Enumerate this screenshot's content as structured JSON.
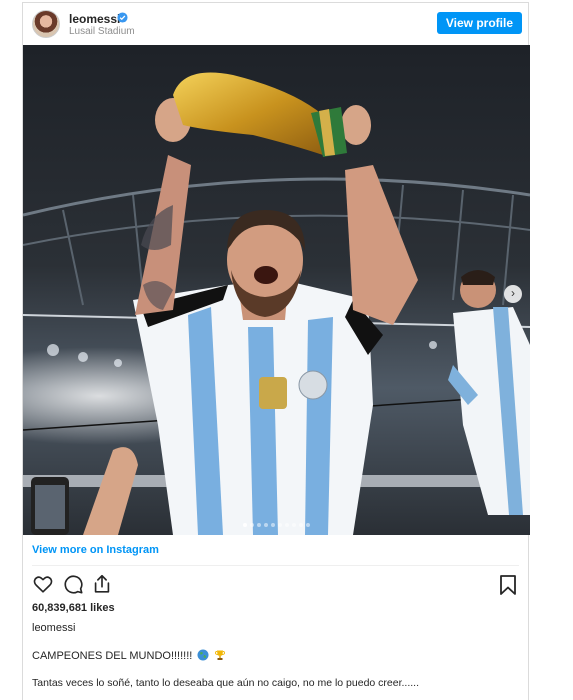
{
  "post": {
    "username": "leomessi",
    "location": "Lusail Stadium",
    "view_profile_label": "View profile",
    "view_more_label": "View more on Instagram",
    "likes": "60,839,681 likes",
    "caption_user": "leomessi",
    "caption_line1": "CAMPEONES DEL MUNDO!!!!!!!",
    "caption_line2": "Tantas veces lo soñé, tanto lo deseaba que aún no caigo, no me lo puedo creer......",
    "carousel_dots": 10,
    "carousel_active": 0
  },
  "icons": {
    "verified": "verified-badge-icon",
    "like": "heart-icon",
    "comment": "comment-icon",
    "share": "share-icon",
    "save": "bookmark-icon",
    "next": "chevron-right-icon",
    "caption_emojis": [
      "globe-emoji-icon",
      "trophy-emoji-icon"
    ]
  },
  "colors": {
    "accent": "#0095f6",
    "text": "#262626",
    "muted": "#8e8e8e",
    "border": "#dbdbdb"
  }
}
